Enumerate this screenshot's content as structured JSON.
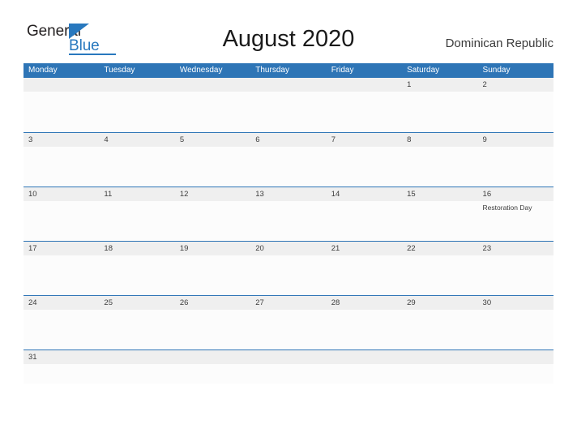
{
  "brand": {
    "name_part1": "General",
    "name_part2": "Blue",
    "triangle_icon": "triangle-icon",
    "color_primary": "#2878be",
    "color_text": "#231f20"
  },
  "header": {
    "title": "August 2020",
    "country": "Dominican Republic"
  },
  "calendar": {
    "header_bg": "#2e75b6",
    "band_bg": "#efefef",
    "cell_bg": "#fcfcfc",
    "border_color": "#2e75b6",
    "weekdays": [
      "Monday",
      "Tuesday",
      "Wednesday",
      "Thursday",
      "Friday",
      "Saturday",
      "Sunday"
    ],
    "weeks": [
      [
        {
          "date": "",
          "event": ""
        },
        {
          "date": "",
          "event": ""
        },
        {
          "date": "",
          "event": ""
        },
        {
          "date": "",
          "event": ""
        },
        {
          "date": "",
          "event": ""
        },
        {
          "date": "1",
          "event": ""
        },
        {
          "date": "2",
          "event": ""
        }
      ],
      [
        {
          "date": "3",
          "event": ""
        },
        {
          "date": "4",
          "event": ""
        },
        {
          "date": "5",
          "event": ""
        },
        {
          "date": "6",
          "event": ""
        },
        {
          "date": "7",
          "event": ""
        },
        {
          "date": "8",
          "event": ""
        },
        {
          "date": "9",
          "event": ""
        }
      ],
      [
        {
          "date": "10",
          "event": ""
        },
        {
          "date": "11",
          "event": ""
        },
        {
          "date": "12",
          "event": ""
        },
        {
          "date": "13",
          "event": ""
        },
        {
          "date": "14",
          "event": ""
        },
        {
          "date": "15",
          "event": ""
        },
        {
          "date": "16",
          "event": "Restoration Day"
        }
      ],
      [
        {
          "date": "17",
          "event": ""
        },
        {
          "date": "18",
          "event": ""
        },
        {
          "date": "19",
          "event": ""
        },
        {
          "date": "20",
          "event": ""
        },
        {
          "date": "21",
          "event": ""
        },
        {
          "date": "22",
          "event": ""
        },
        {
          "date": "23",
          "event": ""
        }
      ],
      [
        {
          "date": "24",
          "event": ""
        },
        {
          "date": "25",
          "event": ""
        },
        {
          "date": "26",
          "event": ""
        },
        {
          "date": "27",
          "event": ""
        },
        {
          "date": "28",
          "event": ""
        },
        {
          "date": "29",
          "event": ""
        },
        {
          "date": "30",
          "event": ""
        }
      ],
      [
        {
          "date": "31",
          "event": ""
        },
        {
          "date": "",
          "event": ""
        },
        {
          "date": "",
          "event": ""
        },
        {
          "date": "",
          "event": ""
        },
        {
          "date": "",
          "event": ""
        },
        {
          "date": "",
          "event": ""
        },
        {
          "date": "",
          "event": ""
        }
      ]
    ]
  }
}
